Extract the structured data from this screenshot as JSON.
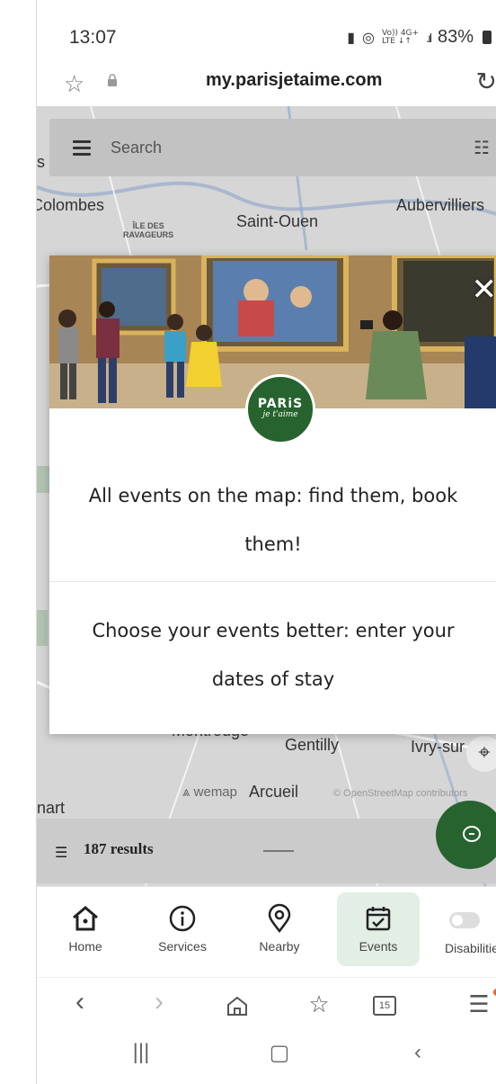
{
  "status_bar": {
    "time": "13:07",
    "network_top": "Vo)) 4G+",
    "network_bottom": "LTE ↓↑",
    "battery": "83%"
  },
  "url_bar": {
    "url": "my.parisjetaime.com"
  },
  "map": {
    "search_placeholder": "Search",
    "labels": {
      "edge_s": "s",
      "colombes": "Colombes",
      "ile_des": "ÎLE DES",
      "ravageurs": "RAVAGEURS",
      "saint_ouen": "Saint-Ouen",
      "aubervilliers": "Aubervilliers",
      "montrouge": "Montrouge",
      "gentilly": "Gentilly",
      "ivry": "Ivry-sur",
      "arcueil": "Arcueil",
      "nart": "nart"
    },
    "wemap": "wemap",
    "attribution": "© OpenStreetMap contributors",
    "results": "187 results"
  },
  "modal": {
    "logo_main": "PARiS",
    "logo_sub": "je t'aime",
    "text_events_map": "All events on the map: find them, book them!",
    "text_dates": "Choose your events better: enter your dates of stay"
  },
  "bottom_nav": {
    "items": [
      {
        "label": "Home"
      },
      {
        "label": "Services"
      },
      {
        "label": "Nearby"
      },
      {
        "label": "Events"
      },
      {
        "label": "Disabilities"
      }
    ],
    "active": "Events"
  },
  "browser_bar": {
    "tabs_count": "15"
  },
  "colors": {
    "brand_green": "#27632e",
    "active_nav_bg": "#e3eee5",
    "notification_dot": "#e8622c"
  }
}
